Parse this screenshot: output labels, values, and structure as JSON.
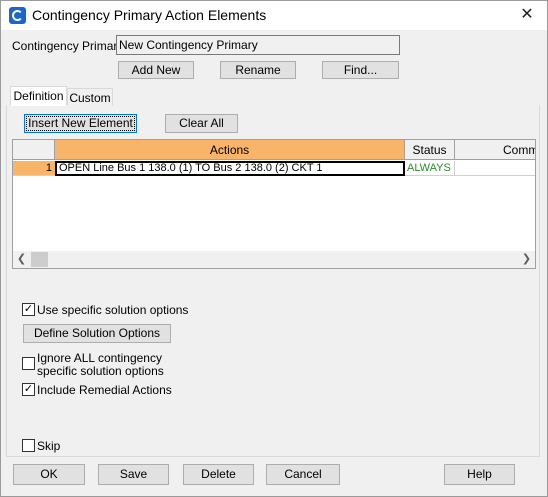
{
  "window": {
    "title": "Contingency Primary Action Elements",
    "close_glyph": "✕",
    "app_icon": "app-logo-icon"
  },
  "header": {
    "name_label": "Contingency Primary",
    "name_value": "New Contingency Primary",
    "add_new_label": "Add New",
    "rename_label": "Rename",
    "find_label": "Find..."
  },
  "tabs": [
    {
      "label": "Definition",
      "active": true
    },
    {
      "label": "Custom",
      "active": false
    }
  ],
  "toolbar": {
    "insert_label": "Insert New Element",
    "clear_label": "Clear All"
  },
  "grid": {
    "columns": [
      "Actions",
      "Status",
      "Comm"
    ],
    "rows": [
      {
        "index": "1",
        "action": "OPEN Line Bus 1  138.0 (1)  TO  Bus 2  138.0 (2) CKT 1",
        "status": "ALWAYS",
        "comment": ""
      }
    ],
    "status_color": "#2e8b2e",
    "header_highlight": "#f8b56a"
  },
  "options": {
    "use_specific_label": "Use specific solution options",
    "use_specific_checked": true,
    "define_options_label": "Define Solution Options",
    "ignore_all_label_1": "Ignore ALL contingency",
    "ignore_all_label_2": "specific solution options",
    "ignore_all_checked": false,
    "include_remedial_label": "Include Remedial Actions",
    "include_remedial_checked": true,
    "skip_label": "Skip",
    "skip_checked": false
  },
  "footer": {
    "ok_label": "OK",
    "save_label": "Save",
    "delete_label": "Delete",
    "cancel_label": "Cancel",
    "help_label": "Help"
  }
}
